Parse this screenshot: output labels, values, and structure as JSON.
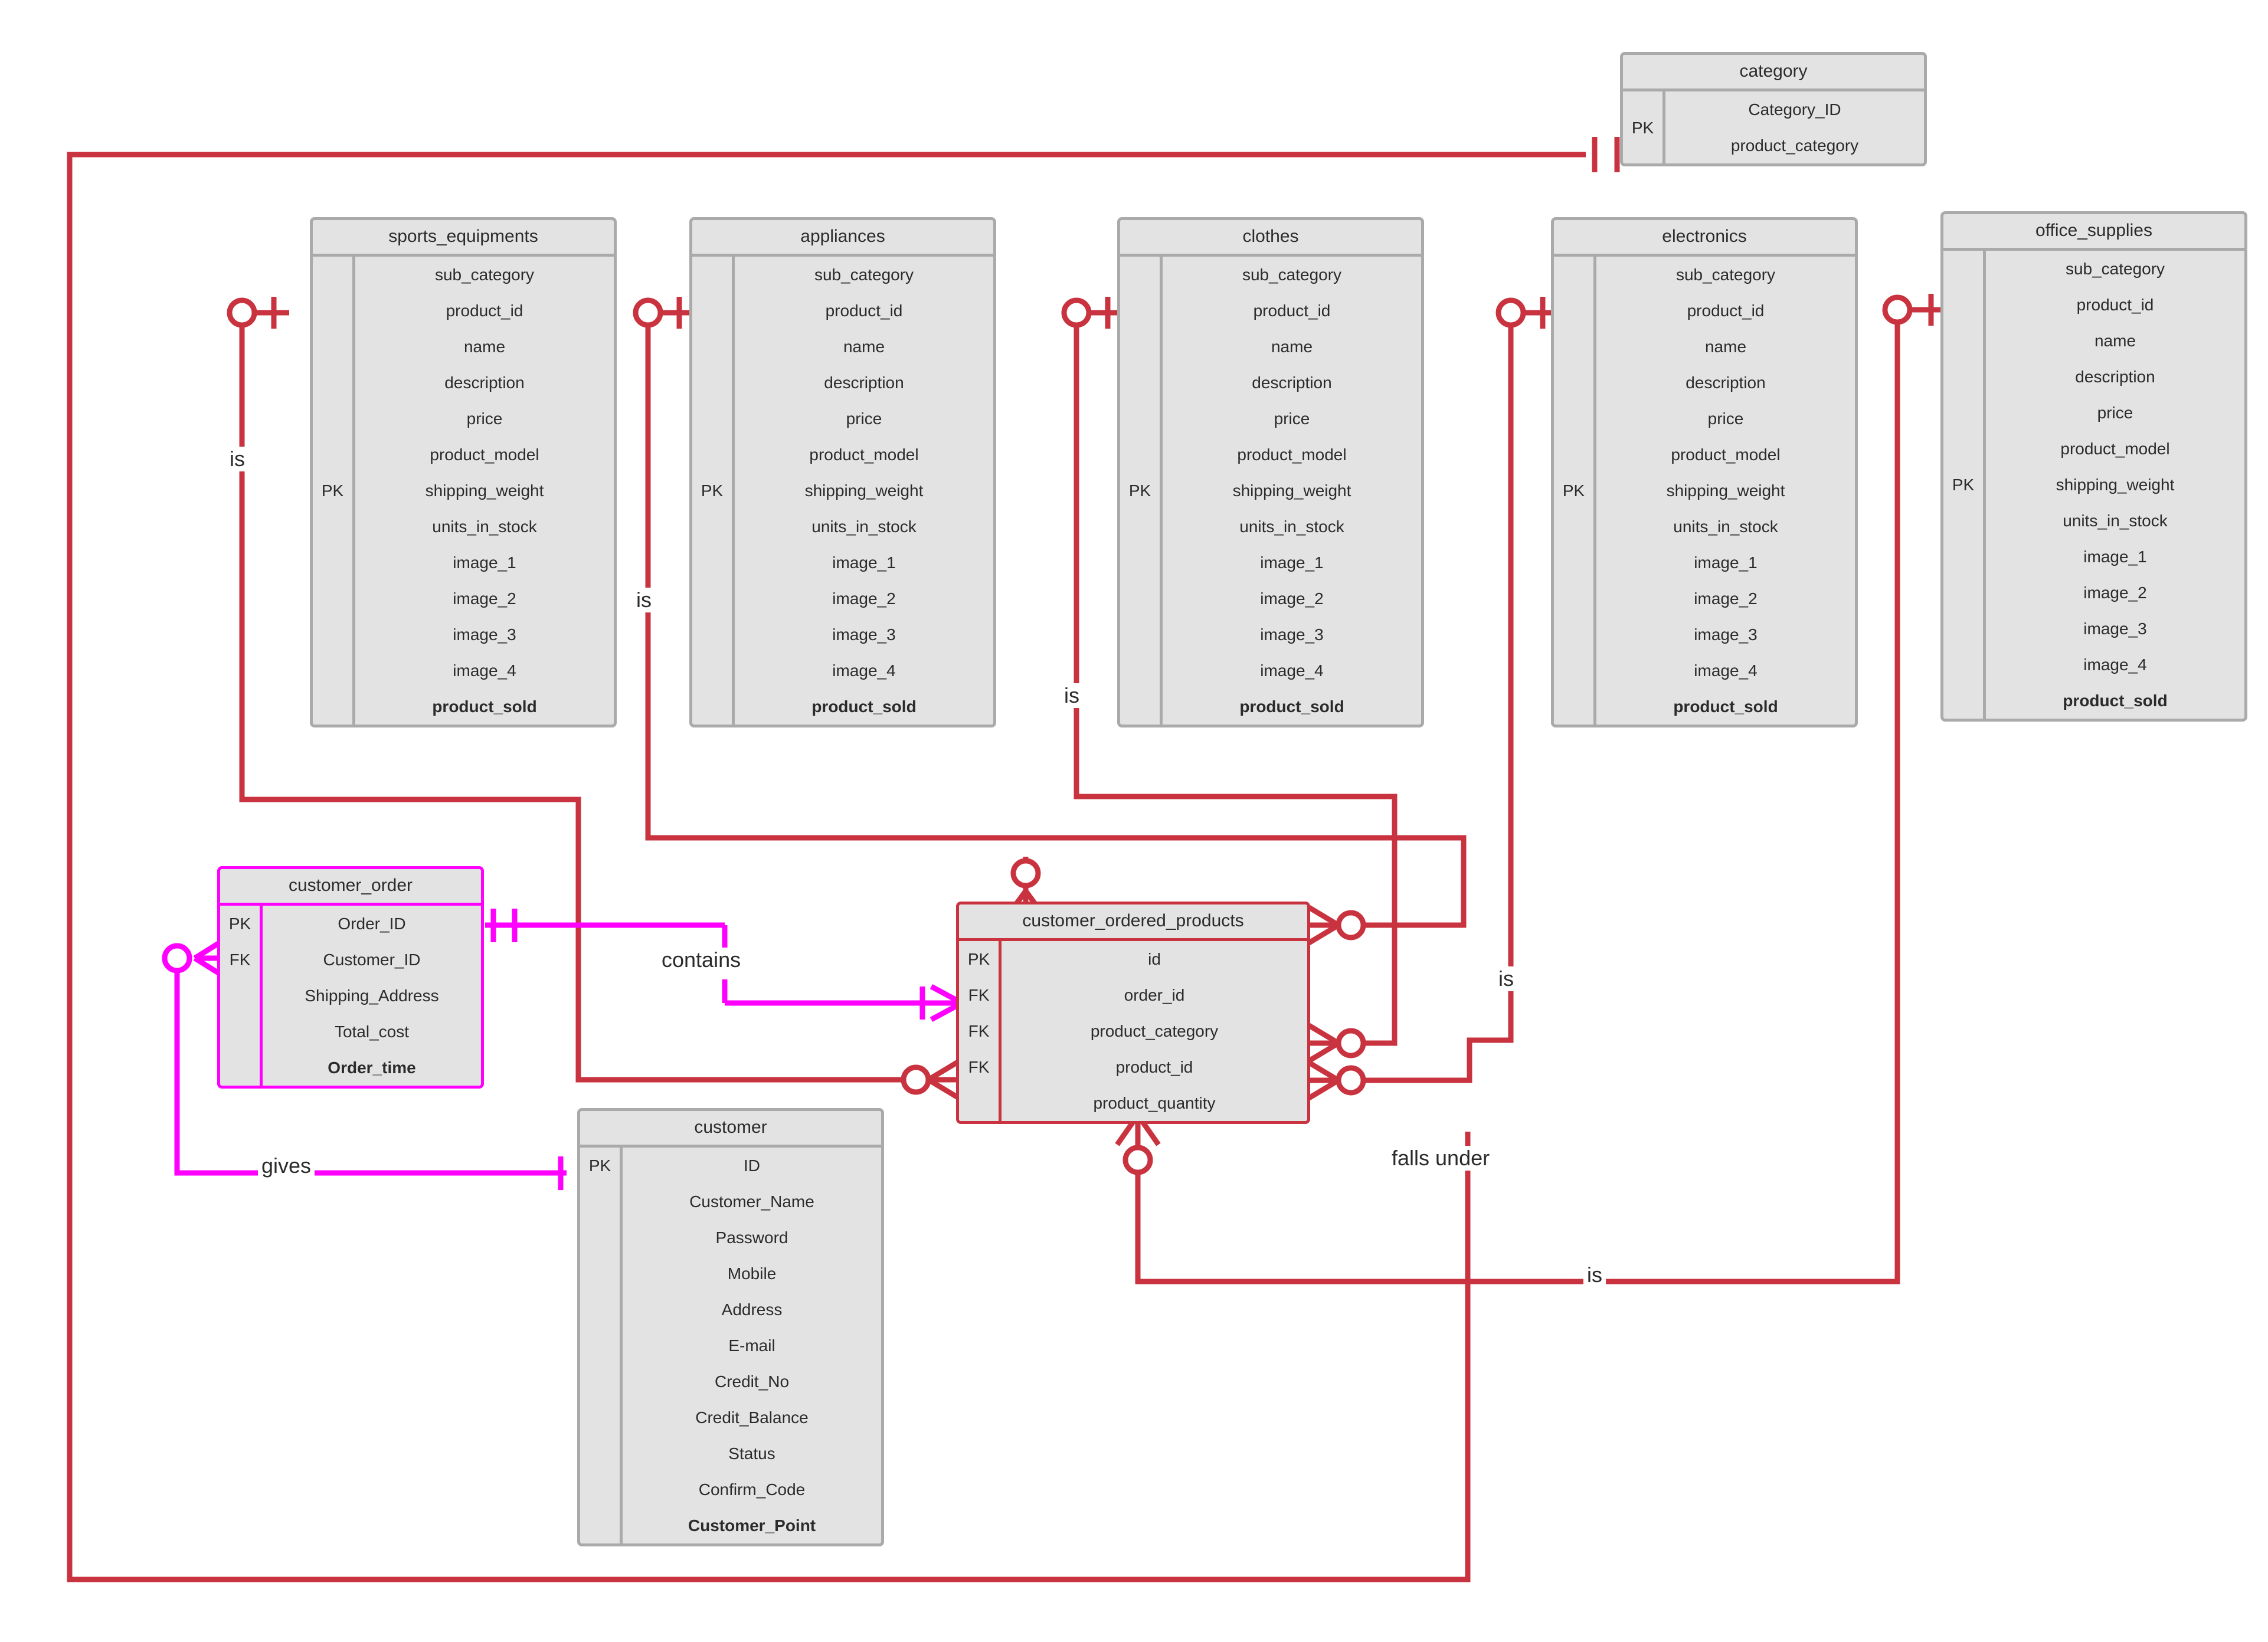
{
  "diagram": {
    "type": "entity-relationship-diagram",
    "notation": "crows-foot",
    "colors": {
      "entity_fill": "#e3e3e3",
      "entity_border_default": "#aaaaaa",
      "relationship_red": "#c9333f",
      "relationship_magenta": "#ff00ff",
      "text": "#2b2b2b",
      "background": "#ffffff"
    }
  },
  "entities": {
    "category": {
      "name": "category",
      "keys": [
        "PK"
      ],
      "attributes": [
        {
          "name": "Category_ID",
          "bold": false
        },
        {
          "name": "product_category",
          "bold": false
        }
      ]
    },
    "sports_equipments": {
      "name": "sports_equipments",
      "keys": [
        "PK"
      ],
      "attributes": [
        {
          "name": "sub_category",
          "bold": false
        },
        {
          "name": "product_id",
          "bold": false
        },
        {
          "name": "name",
          "bold": false
        },
        {
          "name": "description",
          "bold": false
        },
        {
          "name": "price",
          "bold": false
        },
        {
          "name": "product_model",
          "bold": false
        },
        {
          "name": "shipping_weight",
          "bold": false
        },
        {
          "name": "units_in_stock",
          "bold": false
        },
        {
          "name": "image_1",
          "bold": false
        },
        {
          "name": "image_2",
          "bold": false
        },
        {
          "name": "image_3",
          "bold": false
        },
        {
          "name": "image_4",
          "bold": false
        },
        {
          "name": "product_sold",
          "bold": true
        }
      ]
    },
    "appliances": {
      "name": "appliances",
      "keys": [
        "PK"
      ],
      "attributes": [
        {
          "name": "sub_category",
          "bold": false
        },
        {
          "name": "product_id",
          "bold": false
        },
        {
          "name": "name",
          "bold": false
        },
        {
          "name": "description",
          "bold": false
        },
        {
          "name": "price",
          "bold": false
        },
        {
          "name": "product_model",
          "bold": false
        },
        {
          "name": "shipping_weight",
          "bold": false
        },
        {
          "name": "units_in_stock",
          "bold": false
        },
        {
          "name": "image_1",
          "bold": false
        },
        {
          "name": "image_2",
          "bold": false
        },
        {
          "name": "image_3",
          "bold": false
        },
        {
          "name": "image_4",
          "bold": false
        },
        {
          "name": "product_sold",
          "bold": true
        }
      ]
    },
    "clothes": {
      "name": "clothes",
      "keys": [
        "PK"
      ],
      "attributes": [
        {
          "name": "sub_category",
          "bold": false
        },
        {
          "name": "product_id",
          "bold": false
        },
        {
          "name": "name",
          "bold": false
        },
        {
          "name": "description",
          "bold": false
        },
        {
          "name": "price",
          "bold": false
        },
        {
          "name": "product_model",
          "bold": false
        },
        {
          "name": "shipping_weight",
          "bold": false
        },
        {
          "name": "units_in_stock",
          "bold": false
        },
        {
          "name": "image_1",
          "bold": false
        },
        {
          "name": "image_2",
          "bold": false
        },
        {
          "name": "image_3",
          "bold": false
        },
        {
          "name": "image_4",
          "bold": false
        },
        {
          "name": "product_sold",
          "bold": true
        }
      ]
    },
    "electronics": {
      "name": "electronics",
      "keys": [
        "PK"
      ],
      "attributes": [
        {
          "name": "sub_category",
          "bold": false
        },
        {
          "name": "product_id",
          "bold": false
        },
        {
          "name": "name",
          "bold": false
        },
        {
          "name": "description",
          "bold": false
        },
        {
          "name": "price",
          "bold": false
        },
        {
          "name": "product_model",
          "bold": false
        },
        {
          "name": "shipping_weight",
          "bold": false
        },
        {
          "name": "units_in_stock",
          "bold": false
        },
        {
          "name": "image_1",
          "bold": false
        },
        {
          "name": "image_2",
          "bold": false
        },
        {
          "name": "image_3",
          "bold": false
        },
        {
          "name": "image_4",
          "bold": false
        },
        {
          "name": "product_sold",
          "bold": true
        }
      ]
    },
    "office_supplies": {
      "name": "office_supplies",
      "keys": [
        "PK"
      ],
      "attributes": [
        {
          "name": "sub_category",
          "bold": false
        },
        {
          "name": "product_id",
          "bold": false
        },
        {
          "name": "name",
          "bold": false
        },
        {
          "name": "description",
          "bold": false
        },
        {
          "name": "price",
          "bold": false
        },
        {
          "name": "product_model",
          "bold": false
        },
        {
          "name": "shipping_weight",
          "bold": false
        },
        {
          "name": "units_in_stock",
          "bold": false
        },
        {
          "name": "image_1",
          "bold": false
        },
        {
          "name": "image_2",
          "bold": false
        },
        {
          "name": "image_3",
          "bold": false
        },
        {
          "name": "image_4",
          "bold": false
        },
        {
          "name": "product_sold",
          "bold": true
        }
      ]
    },
    "customer_order": {
      "name": "customer_order",
      "keys": [
        "PK",
        "FK"
      ],
      "attributes": [
        {
          "name": "Order_ID",
          "bold": false
        },
        {
          "name": "Customer_ID",
          "bold": false
        },
        {
          "name": "Shipping_Address",
          "bold": false
        },
        {
          "name": "Total_cost",
          "bold": false
        },
        {
          "name": "Order_time",
          "bold": true
        }
      ]
    },
    "customer_ordered_products": {
      "name": "customer_ordered_products",
      "keys": [
        "PK",
        "FK",
        "FK",
        "FK"
      ],
      "attributes": [
        {
          "name": "id",
          "bold": false
        },
        {
          "name": "order_id",
          "bold": false
        },
        {
          "name": "product_category",
          "bold": false
        },
        {
          "name": "product_id",
          "bold": false
        },
        {
          "name": "product_quantity",
          "bold": false
        }
      ]
    },
    "customer": {
      "name": "customer",
      "keys": [
        "PK"
      ],
      "attributes": [
        {
          "name": "ID",
          "bold": false
        },
        {
          "name": "Customer_Name",
          "bold": false
        },
        {
          "name": "Password",
          "bold": false
        },
        {
          "name": "Mobile",
          "bold": false
        },
        {
          "name": "Address",
          "bold": false
        },
        {
          "name": "E-mail",
          "bold": false
        },
        {
          "name": "Credit_No",
          "bold": false
        },
        {
          "name": "Credit_Balance",
          "bold": false
        },
        {
          "name": "Status",
          "bold": false
        },
        {
          "name": "Confirm_Code",
          "bold": false
        },
        {
          "name": "Customer_Point",
          "bold": true
        }
      ]
    }
  },
  "relationships": [
    {
      "id": "is_sports",
      "label": "is",
      "color": "#c9333f",
      "from": "customer_ordered_products",
      "to": "sports_equipments",
      "from_card": "zero-or-many",
      "to_card": "zero-or-one"
    },
    {
      "id": "is_appliances",
      "label": "is",
      "color": "#c9333f",
      "from": "customer_ordered_products",
      "to": "appliances",
      "from_card": "zero-or-many",
      "to_card": "zero-or-one"
    },
    {
      "id": "is_clothes",
      "label": "is",
      "color": "#c9333f",
      "from": "customer_ordered_products",
      "to": "clothes",
      "from_card": "zero-or-many",
      "to_card": "zero-or-one"
    },
    {
      "id": "is_electronics",
      "label": "is",
      "color": "#c9333f",
      "from": "customer_ordered_products",
      "to": "electronics",
      "from_card": "zero-or-many",
      "to_card": "zero-or-one"
    },
    {
      "id": "is_office_supplies",
      "label": "is",
      "color": "#c9333f",
      "from": "customer_ordered_products",
      "to": "office_supplies",
      "from_card": "zero-or-many",
      "to_card": "zero-or-one"
    },
    {
      "id": "falls_under",
      "label": "falls under",
      "color": "#c9333f",
      "from": "customer_ordered_products",
      "to": "category",
      "from_card": "zero-or-many",
      "to_card": "exactly-one"
    },
    {
      "id": "contains",
      "label": "contains",
      "color": "#ff00ff",
      "from": "customer_order",
      "to": "customer_ordered_products",
      "from_card": "exactly-one",
      "to_card": "one-or-many"
    },
    {
      "id": "gives",
      "label": "gives",
      "color": "#ff00ff",
      "from": "customer",
      "to": "customer_order",
      "from_card": "exactly-one",
      "to_card": "zero-or-many"
    }
  ],
  "labels": {
    "is_1": "is",
    "is_2": "is",
    "is_3": "is",
    "is_4": "is",
    "is_5": "is",
    "contains": "contains",
    "gives": "gives",
    "falls_under": "falls under"
  }
}
